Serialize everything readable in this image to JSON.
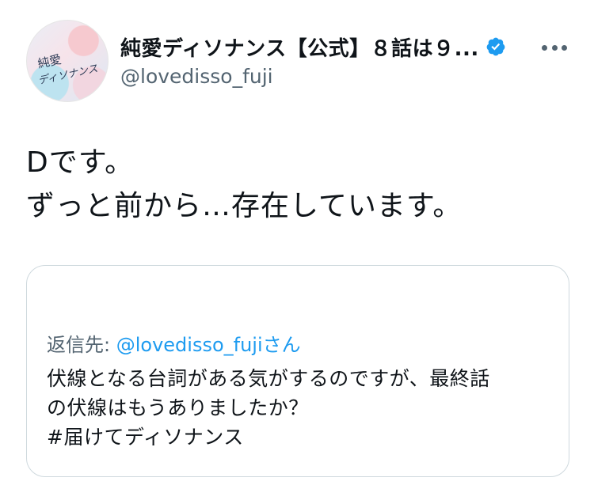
{
  "author": {
    "display_name": "純愛ディソナンス【公式】８話は９...",
    "handle": "@lovedisso_fuji",
    "verified": true,
    "avatar_text": "純愛ディソナンス",
    "verified_color": "#1d9bf0"
  },
  "tweet": {
    "lines": [
      "Dです。",
      "ずっと前から…存在しています。"
    ]
  },
  "quoted": {
    "reply_label": "返信先: ",
    "reply_mention": "@lovedisso_fuji",
    "reply_suffix": "さん",
    "lines": [
      "伏線となる台詞がある気がするのですが、最終話",
      "の伏線はもうありましたか？",
      "#届けてディソナンス"
    ]
  },
  "icons": {
    "more": "more-horizontal-icon",
    "verified": "verified-badge-icon"
  }
}
